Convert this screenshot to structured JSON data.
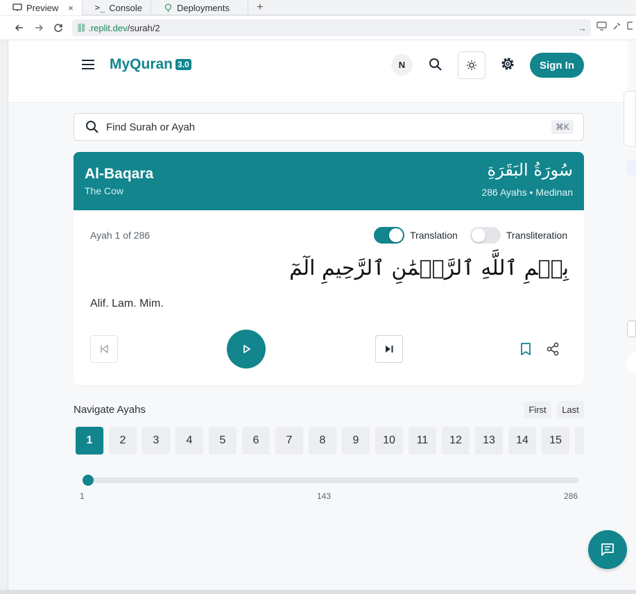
{
  "browser": {
    "tabs": [
      {
        "label": "Preview",
        "icon": "monitor-icon",
        "active": true
      },
      {
        "label": "Console",
        "icon": "terminal-icon",
        "active": false
      },
      {
        "label": "Deployments",
        "icon": "deploy-icon",
        "active": false
      }
    ],
    "url_host": ".replit.dev",
    "url_path": "/surah/2"
  },
  "header": {
    "brand": "MyQuran",
    "version": "3.0",
    "avatar_initial": "N",
    "sign_in": "Sign In"
  },
  "search": {
    "placeholder": "Find Surah or Ayah",
    "shortcut": "⌘K"
  },
  "surah": {
    "name": "Al-Baqara",
    "meaning": "The Cow",
    "arabic_name": "سُورَةُ البَقَرَةِ",
    "meta": "286 Ayahs • Medinan"
  },
  "ayah": {
    "counter": "Ayah 1 of 286",
    "translation_label": "Translation",
    "translation_on": true,
    "transliteration_label": "Transliteration",
    "transliteration_on": false,
    "arabic": "بِسۡمِ ٱللَّهِ ٱلرَّحۡمَٰنِ ٱلرَّحِيمِ الٓمٓ",
    "translation": "Alif. Lam. Mim."
  },
  "navigator": {
    "title": "Navigate Ayahs",
    "first": "First",
    "last": "Last",
    "pages": [
      "1",
      "2",
      "3",
      "4",
      "5",
      "6",
      "7",
      "8",
      "9",
      "10",
      "11",
      "12",
      "13",
      "14",
      "15"
    ],
    "active_page": "1",
    "slider_min": "1",
    "slider_mid": "143",
    "slider_max": "286",
    "slider_value": 1
  },
  "colors": {
    "accent": "#12858d"
  }
}
